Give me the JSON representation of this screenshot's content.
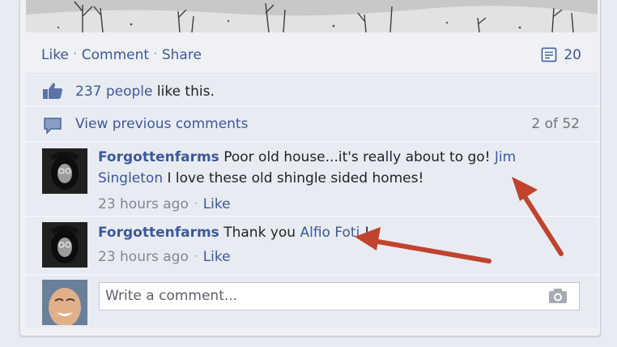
{
  "actions": {
    "like": "Like",
    "comment": "Comment",
    "share": "Share",
    "comment_count": "20"
  },
  "likes": {
    "people": "237 people",
    "suffix": " like this."
  },
  "previous": {
    "label": "View previous comments",
    "count": "2 of 52"
  },
  "comments": [
    {
      "author": "Forgottenfarms",
      "text_before": " Poor old house...it's really about to go! ",
      "mention": "Jim Singleton",
      "text_after": " I love these old shingle sided homes!",
      "time": "23 hours ago",
      "like": "Like"
    },
    {
      "author": "Forgottenfarms",
      "text_before": " Thank you ",
      "mention": "Alfio Foti",
      "text_after": " !",
      "time": "23 hours ago",
      "like": "Like"
    }
  ],
  "composer": {
    "placeholder": "Write a comment..."
  },
  "colors": {
    "link": "#3b5998",
    "arrow": "#c0432e",
    "row_bg": "#e9ebf2"
  },
  "icons": [
    "comment-count-icon",
    "thumbs-up-icon",
    "speech-bubble-icon",
    "camera-icon"
  ]
}
